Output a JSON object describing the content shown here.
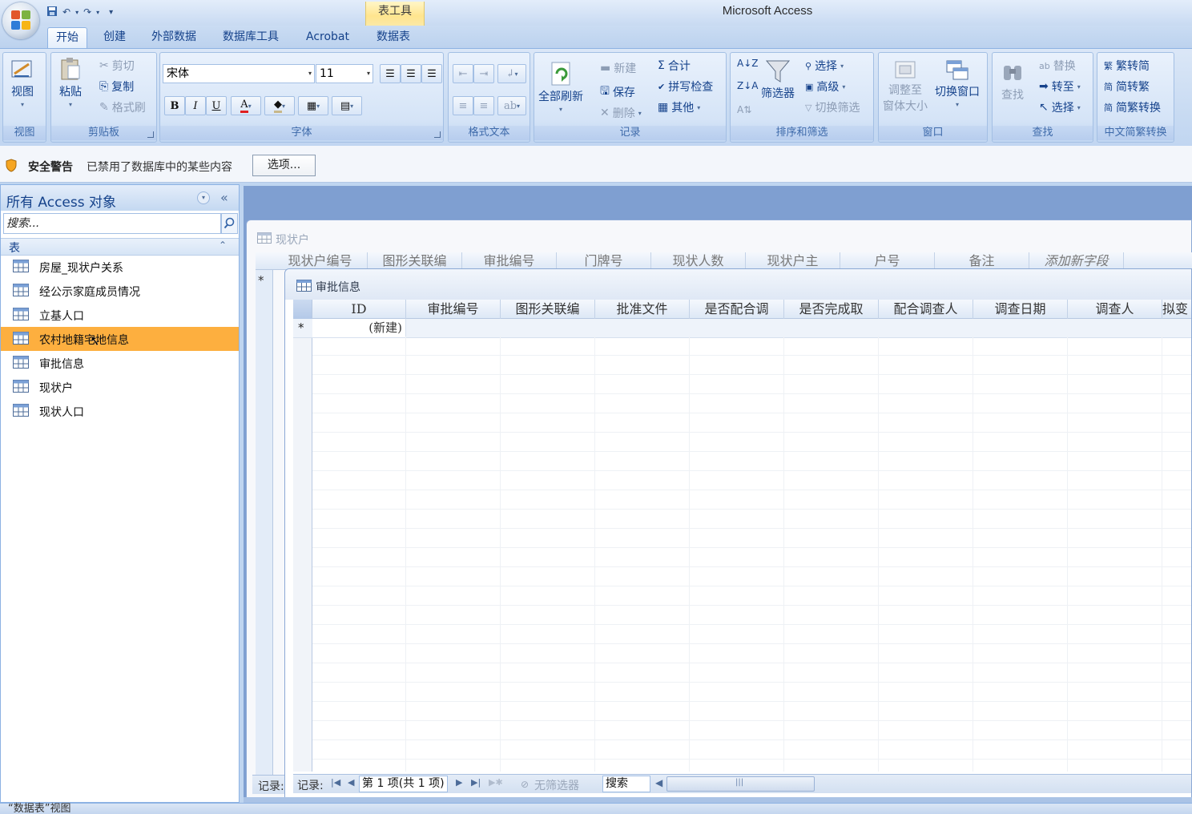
{
  "app": {
    "title": "Microsoft Access",
    "context_tab_group": "表工具"
  },
  "ribbon_tabs": [
    "开始",
    "创建",
    "外部数据",
    "数据库工具",
    "Acrobat",
    "数据表"
  ],
  "ribbon": {
    "view": {
      "label": "视图",
      "group": "视图"
    },
    "clipboard": {
      "paste": "粘贴",
      "cut": "剪切",
      "copy": "复制",
      "format_painter": "格式刷",
      "group": "剪贴板"
    },
    "font": {
      "font_name": "宋体",
      "font_size": "11",
      "bold": "B",
      "italic": "I",
      "underline": "U",
      "group": "字体"
    },
    "rich_text": {
      "group": "格式文本"
    },
    "records": {
      "refresh_all": "全部刷新",
      "new": "新建",
      "save": "保存",
      "delete": "删除",
      "totals": "合计",
      "spelling": "拼写检查",
      "more": "其他",
      "group": "记录"
    },
    "sort_filter": {
      "filter": "筛选器",
      "selection": "选择",
      "advanced": "高级",
      "toggle_filter": "切换筛选",
      "group": "排序和筛选"
    },
    "window": {
      "size_to_fit_line1": "调整至",
      "size_to_fit_line2": "窗体大小",
      "switch_windows": "切换窗口",
      "group": "窗口"
    },
    "find": {
      "find": "查找",
      "replace": "替换",
      "goto": "转至",
      "select": "选择",
      "group": "查找"
    },
    "chinese_conversion": {
      "trad_to_simp": "繁转简",
      "simp_to_trad": "简转繁",
      "convert": "简繁转换",
      "group": "中文简繁转换"
    }
  },
  "security_bar": {
    "title": "安全警告",
    "message": "已禁用了数据库中的某些内容",
    "options_button": "选项..."
  },
  "nav_pane": {
    "title": "所有 Access 对象",
    "search_placeholder": "搜索...",
    "group_label": "表",
    "items": [
      {
        "label": "房屋_现状户关系",
        "selected": false
      },
      {
        "label": "经公示家庭成员情况",
        "selected": false
      },
      {
        "label": "立基人口",
        "selected": false
      },
      {
        "label": "农村地籍宅地信息",
        "selected": true
      },
      {
        "label": "审批信息",
        "selected": false
      },
      {
        "label": "现状户",
        "selected": false
      },
      {
        "label": "现状人口",
        "selected": false
      }
    ]
  },
  "window_back": {
    "title": "现状户",
    "columns": [
      "现状户编号",
      "图形关联编",
      "审批编号",
      "门牌号",
      "现状人数",
      "现状户主",
      "户号",
      "备注",
      "添加新字段"
    ],
    "new_row_marker": "*",
    "record_label": "记录:"
  },
  "window_front": {
    "title": "审批信息",
    "columns": [
      "ID",
      "审批编号",
      "图形关联编",
      "批准文件",
      "是否配合调",
      "是否完成取",
      "配合调查人",
      "调查日期",
      "调查人",
      "拟变"
    ],
    "new_row_marker": "*",
    "new_row_value": "(新建)",
    "record_nav": {
      "label": "记录:",
      "position": "第 1 项(共 1 项)",
      "filter_status": "无筛选器",
      "search": "搜索"
    }
  },
  "status_bar": {
    "text": "“数据表”视图"
  }
}
